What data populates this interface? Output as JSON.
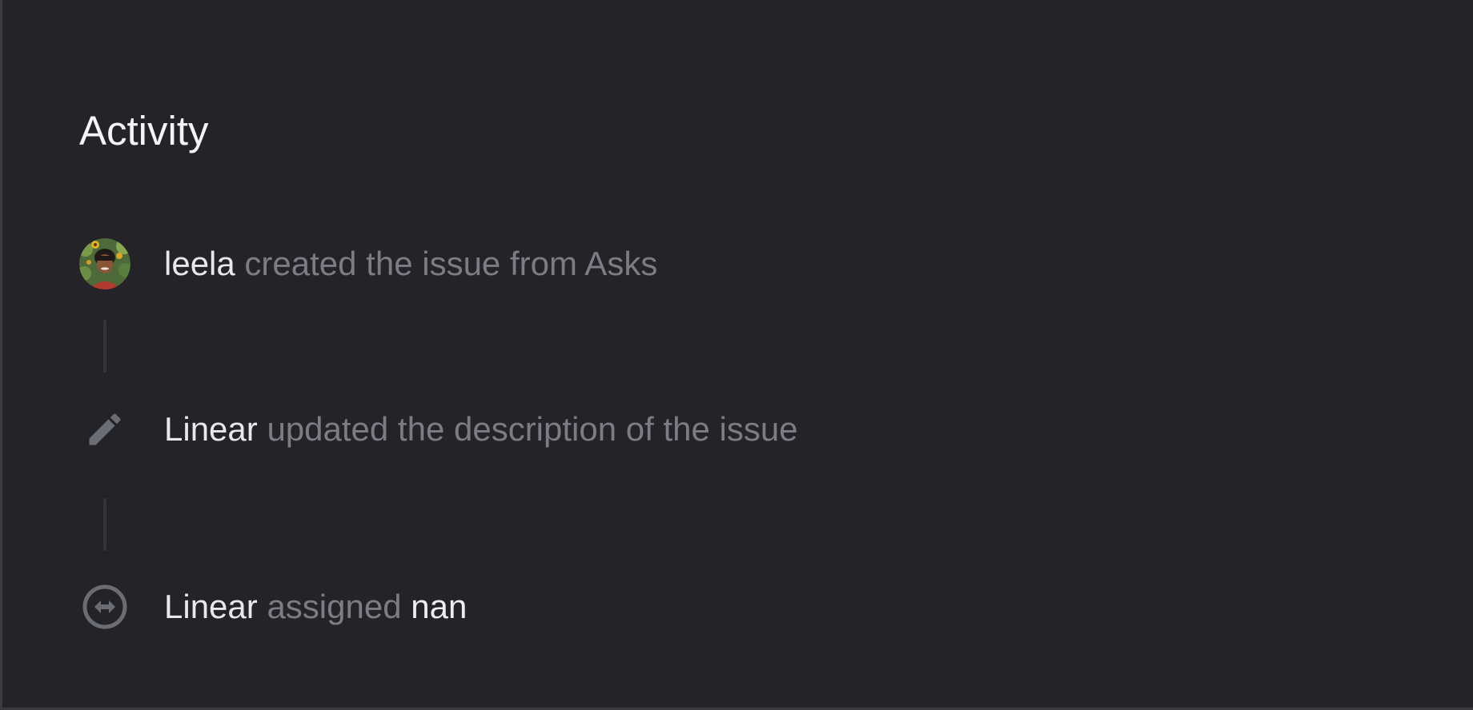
{
  "section": {
    "title": "Activity"
  },
  "activity": [
    {
      "icon": "avatar",
      "actor": "leela",
      "action": "created the issue from Asks",
      "target": ""
    },
    {
      "icon": "pencil-icon",
      "actor": "Linear",
      "action": "updated the description of the issue",
      "target": ""
    },
    {
      "icon": "assign-icon",
      "actor": "Linear",
      "action": "assigned",
      "target": "nan"
    }
  ],
  "colors": {
    "background": "#232328",
    "title": "#f4f4f6",
    "actor": "#e8e8ec",
    "action": "#7c7c85",
    "icon": "#6b6d75"
  }
}
